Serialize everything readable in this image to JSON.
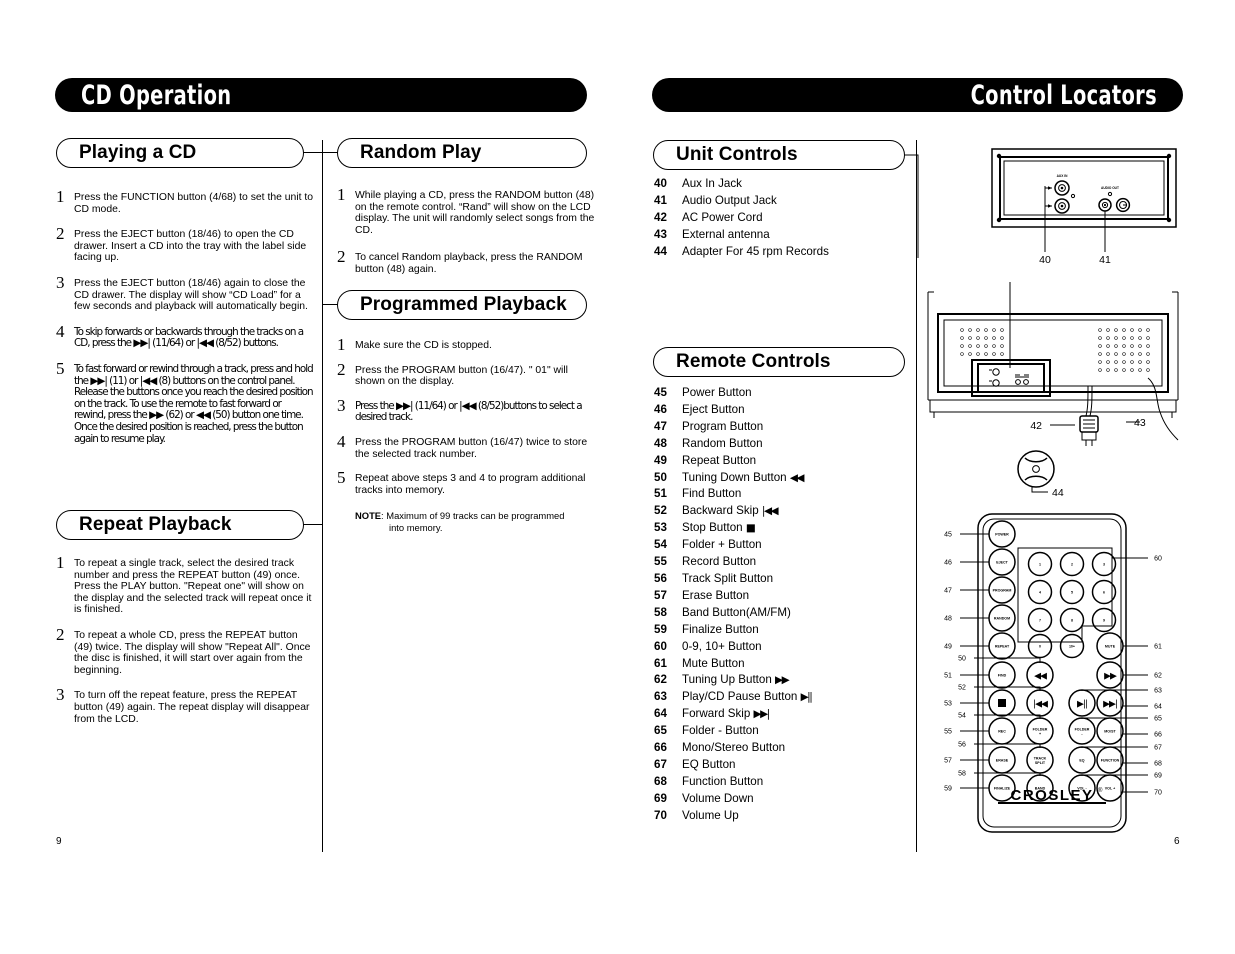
{
  "left_page": {
    "banner_title": "CD Operation",
    "page_number": "9",
    "sections": [
      {
        "heading": "Playing a CD",
        "steps": [
          {
            "num": "1",
            "text": "Press the FUNCTION button (4/68) to set the unit to CD mode."
          },
          {
            "num": "2",
            "text": "Press the EJECT button (18/46) to open the CD drawer. Insert a CD into the tray with the label side facing up."
          },
          {
            "num": "3",
            "text": "Press the EJECT button (18/46) again to close the CD drawer. The display will show “CD Load” for a few seconds and playback will automatically begin."
          },
          {
            "num": "4",
            "text": "To skip forwards or backwards through the tracks on a CD, press the ▶▶| (11/64) or |◀◀ (8/52) buttons."
          },
          {
            "num": "5",
            "text": "To fast forward or rewind through a track, press and hold the ▶▶| (11) or |◀◀ (8) buttons on the control panel. Release the buttons once you reach the desired position on the track. To use the remote to fast forward or rewind, press the ▶▶ (62) or ◀◀ (50) button one time. Once the desired position is reached, press the button again to resume play."
          }
        ]
      },
      {
        "heading": "Repeat Playback",
        "steps": [
          {
            "num": "1",
            "text": "To repeat a single track, select the desired track number and press the REPEAT button (49) once. Press the PLAY button. \"Repeat one\" will show on the display and the selected track will repeat once it is finished."
          },
          {
            "num": "2",
            "text": "To repeat a whole CD, press the REPEAT button (49) twice. The display will show \"Repeat All\". Once the disc is finished, it will start over again from the beginning."
          },
          {
            "num": "3",
            "text": "To turn off the repeat feature, press the REPEAT button (49) again. The repeat display will disappear from the LCD."
          }
        ]
      },
      {
        "heading": "Random Play",
        "steps": [
          {
            "num": "1",
            "text": "While playing a CD, press the RANDOM button (48) on the remote control. “Rand” will show on the LCD display. The unit will randomly select songs from the CD."
          },
          {
            "num": "2",
            "text": "To cancel Random playback, press the RANDOM button (48) again."
          }
        ]
      },
      {
        "heading": "Programmed Playback",
        "steps": [
          {
            "num": "1",
            "text": "Make sure the CD is stopped."
          },
          {
            "num": "2",
            "text": "Press the PROGRAM button (16/47). \" 01\" will shown on the display."
          },
          {
            "num": "3",
            "text": "Press the ▶▶| (11/64) or  |◀◀ (8/52)buttons to select a desired track."
          },
          {
            "num": "4",
            "text": "Press the PROGRAM button (16/47) twice to store the selected track number."
          },
          {
            "num": "5",
            "text": "Repeat above steps 3 and 4 to program additional tracks into memory."
          }
        ],
        "note_label": "NOTE",
        "note_text": ": Maximum of 99 tracks can be programmed",
        "note_text2": "into memory."
      }
    ]
  },
  "right_page": {
    "banner_title": "Control Locators",
    "page_number": "6",
    "unit_controls": {
      "heading": "Unit Controls",
      "items": [
        {
          "n": "40",
          "label": "Aux In Jack"
        },
        {
          "n": "41",
          "label": "Audio Output Jack"
        },
        {
          "n": "42",
          "label": "AC Power Cord"
        },
        {
          "n": "43",
          "label": "External antenna"
        },
        {
          "n": "44",
          "label": "Adapter For 45 rpm Records"
        }
      ]
    },
    "remote_controls": {
      "heading": "Remote Controls",
      "items": [
        {
          "n": "45",
          "label": "Power Button",
          "sym": ""
        },
        {
          "n": "46",
          "label": "Eject Button",
          "sym": ""
        },
        {
          "n": "47",
          "label": "Program Button",
          "sym": ""
        },
        {
          "n": "48",
          "label": "Random Button",
          "sym": ""
        },
        {
          "n": "49",
          "label": "Repeat Button",
          "sym": ""
        },
        {
          "n": "50",
          "label": "Tuning Down Button ",
          "sym": "◀◀"
        },
        {
          "n": "51",
          "label": "Find Button",
          "sym": ""
        },
        {
          "n": "52",
          "label": "Backward Skip ",
          "sym": "|◀◀"
        },
        {
          "n": "53",
          "label": "Stop Button ",
          "sym": "■"
        },
        {
          "n": "54",
          "label": "Folder + Button",
          "sym": ""
        },
        {
          "n": "55",
          "label": "Record Button",
          "sym": ""
        },
        {
          "n": "56",
          "label": "Track Split Button",
          "sym": ""
        },
        {
          "n": "57",
          "label": "Erase Button",
          "sym": ""
        },
        {
          "n": "58",
          "label": "Band Button(AM/FM)",
          "sym": ""
        },
        {
          "n": "59",
          "label": "Finalize Button",
          "sym": ""
        },
        {
          "n": "60",
          "label": "0-9, 10+ Button",
          "sym": ""
        },
        {
          "n": "61",
          "label": "Mute Button",
          "sym": ""
        },
        {
          "n": "62",
          "label": "Tuning Up Button ",
          "sym": "▶▶"
        },
        {
          "n": "63",
          "label": "Play/CD Pause Button ",
          "sym": "▶||"
        },
        {
          "n": "64",
          "label": "Forward Skip ",
          "sym": "▶▶|"
        },
        {
          "n": "65",
          "label": "Folder - Button",
          "sym": ""
        },
        {
          "n": "66",
          "label": "Mono/Stereo Button",
          "sym": ""
        },
        {
          "n": "67",
          "label": "EQ Button",
          "sym": ""
        },
        {
          "n": "68",
          "label": "Function Button",
          "sym": ""
        },
        {
          "n": "69",
          "label": "Volume Down",
          "sym": ""
        },
        {
          "n": "70",
          "label": "Volume Up",
          "sym": ""
        }
      ]
    },
    "rear_panel_diagram": {
      "aux_in_label": "AUX IN",
      "audio_out_label": "AUDIO OUT",
      "callouts": [
        "40",
        "41"
      ]
    },
    "unit_diagram": {
      "callouts": [
        "42",
        "43",
        "44"
      ]
    },
    "remote_diagram": {
      "brand": "CROSLEY",
      "brand_mark": "®",
      "buttons": [
        {
          "label": "POWER"
        },
        {
          "label": "EJECT"
        },
        {
          "label": "PROGRAM"
        },
        {
          "label": "RANDOM"
        },
        {
          "label": "REPEAT"
        },
        {
          "label": "FIND"
        },
        {
          "label": "REC"
        },
        {
          "label": "ERASE"
        },
        {
          "label": "FINALIZE"
        },
        {
          "label": "FOLDER +"
        },
        {
          "label": "TRACK SPLIT"
        },
        {
          "label": "BAND"
        },
        {
          "label": "FOLDER -"
        },
        {
          "label": "EQ"
        },
        {
          "label": "VOL -"
        },
        {
          "label": "MO/ST"
        },
        {
          "label": "FUNCTION"
        },
        {
          "label": "VOL +"
        },
        {
          "label": "MUTE"
        }
      ],
      "keypad": [
        "1",
        "2",
        "3",
        "4",
        "5",
        "6",
        "7",
        "8",
        "9",
        "0",
        "10+"
      ],
      "left_callouts": [
        "45",
        "46",
        "47",
        "48",
        "49",
        "50",
        "51",
        "52",
        "53",
        "54",
        "55",
        "56",
        "57",
        "58",
        "59"
      ],
      "right_callouts": [
        "60",
        "61",
        "62",
        "63",
        "64",
        "65",
        "66",
        "67",
        "68",
        "69",
        "70"
      ]
    }
  }
}
